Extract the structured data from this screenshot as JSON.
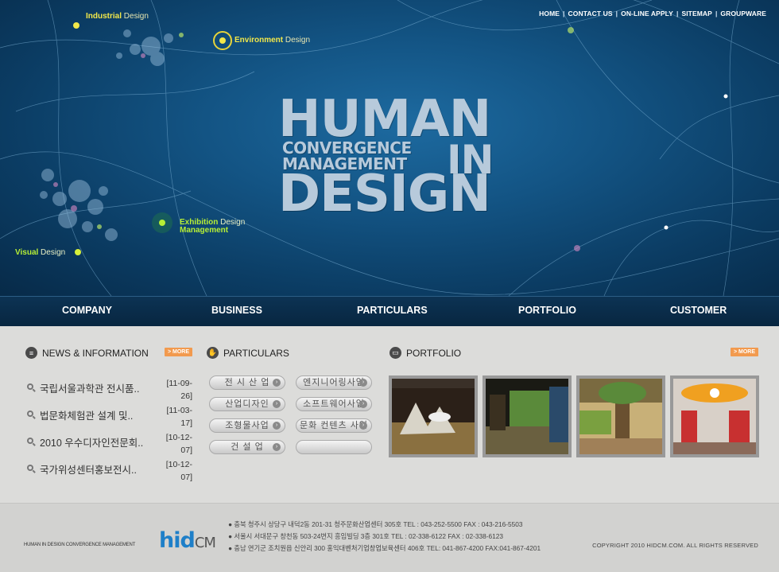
{
  "top_nav": [
    "HOME",
    "CONTACT US",
    "ON-LINE APPLY",
    "SITEMAP",
    "GROUPWARE"
  ],
  "hero": {
    "labels": {
      "industrial": {
        "strong": "Industrial",
        "rest": " Design"
      },
      "environment": {
        "strong": "Environment",
        "rest": " Design"
      },
      "exhibition": {
        "strong": "Exhibition",
        "rest": " Design"
      },
      "exhibition_line2": "Management",
      "visual": {
        "strong": "Visual",
        "rest": " Design"
      }
    },
    "headline": {
      "human": "HUMAN",
      "convergence": "CONVERGENCE",
      "management": "MANAGEMENT",
      "in": "IN",
      "design": "DESIGN"
    }
  },
  "main_nav": [
    "COMPANY",
    "BUSINESS",
    "PARTICULARS",
    "PORTFOLIO",
    "CUSTOMER"
  ],
  "news": {
    "title": "NEWS & INFORMATION",
    "more": "> MORE",
    "items": [
      {
        "title": "국립서울과학관 전시품..",
        "date": "[11-09-\n26]"
      },
      {
        "title": "법문화체험관 설계 및..",
        "date": "[11-03-\n17]"
      },
      {
        "title": "2010 우수디자인전문회..",
        "date": "[10-12-\n07]"
      },
      {
        "title": "국가위성센터홍보전시..",
        "date": "[10-12-\n07]"
      }
    ]
  },
  "particulars": {
    "title": "PARTICULARS",
    "buttons": [
      "전 시 산 업",
      "엔지니어링사업",
      "산업디자인",
      "소프트웨어사업",
      "조형물사업",
      "문화 컨텐츠 사업",
      "건 설 업",
      ""
    ]
  },
  "portfolio": {
    "title": "PORTFOLIO",
    "more": "> MORE"
  },
  "footer": {
    "tagline": "HUMAN IN DESIGN CONVERGENCE MANAGEMENT",
    "logo_main": "hid",
    "logo_sub": "CM",
    "addresses": [
      "● 충북 청주시 상당구 내덕2동 201-31 청주문화산업센터 305호 TEL : 043-252-5500   FAX : 043-216-5503",
      "● 서울시 서대문구 창천동 503-24번지 흥임빌딩 3층 301호 TEL : 02-338-6122   FAX : 02-338-6123",
      "● 충남 연기군 조치원읍 신안리 300 홍익대벤처기업창업보육센터 406호 TEL: 041-867-4200 FAX:041-867-4201"
    ],
    "copyright": "COPYRIGHT 2010 HIDCM.COM. ALL RIGHTS RESERVED"
  }
}
